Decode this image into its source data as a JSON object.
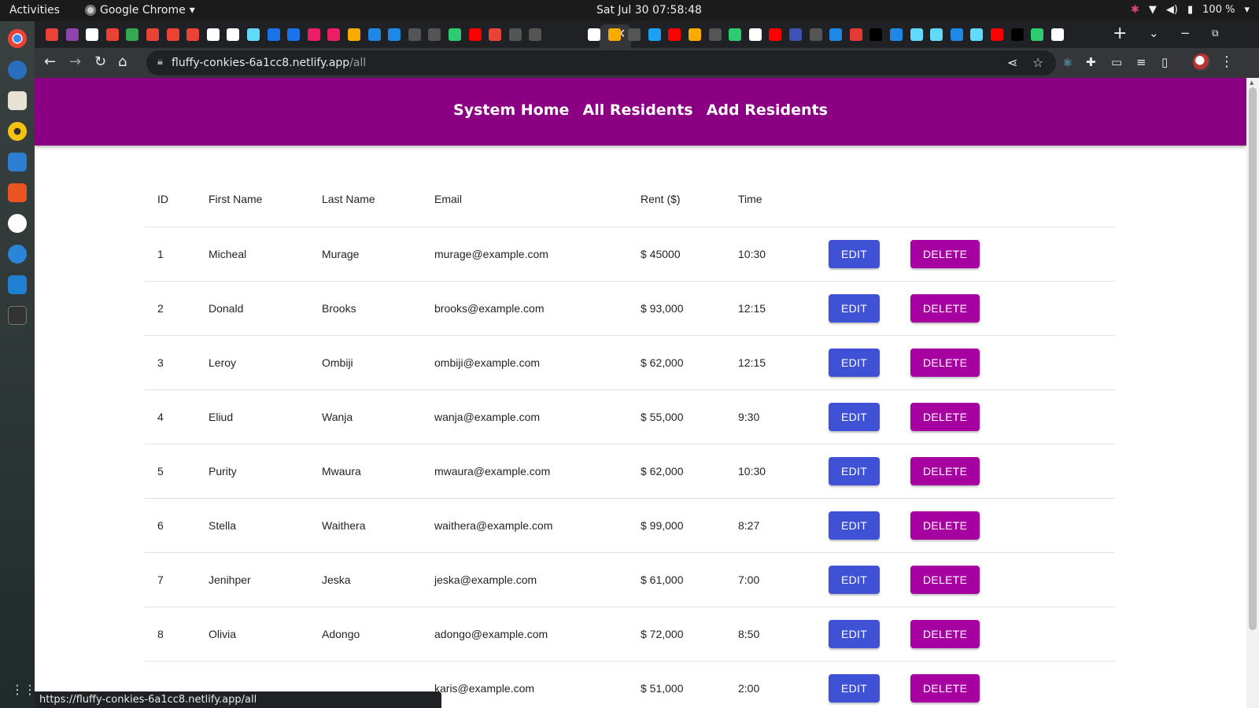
{
  "system": {
    "activities": "Activities",
    "app_name": "Google Chrome",
    "clock": "Sat Jul 30  07:58:48",
    "battery": "100 %"
  },
  "browser": {
    "url_host": "fluffy-conkies-6a1cc8.netlify.app",
    "url_path": "/all",
    "status_url": "https://fluffy-conkies-6a1cc8.netlify.app/all",
    "tab_icon_colors": [
      "#ea4335",
      "#8e44ad",
      "#ffffff",
      "#ea4335",
      "#34a853",
      "#ea4335",
      "#ea4335",
      "#ea4335",
      "#ffffff",
      "#ffffff",
      "#61dafb",
      "#1a73e8",
      "#1a73e8",
      "#e91e63",
      "#e91e63",
      "#f9ab00",
      "#1e88e5",
      "#1e88e5",
      "#555555",
      "#555555",
      "#2ecc71",
      "#ff0000",
      "#ea4335",
      "#555555",
      "#555555"
    ],
    "tab_icon_colors_right": [
      "#ffffff",
      "#f9ab00",
      "#555555",
      "#1da1f2",
      "#ff0000",
      "#f9ab00",
      "#555555",
      "#2ecc71",
      "#ffffff",
      "#ff0000",
      "#3f51b5",
      "#555555",
      "#1e88e5",
      "#e53935",
      "#000000",
      "#1e88e5",
      "#61dafb",
      "#61dafb",
      "#1e88e5",
      "#61dafb",
      "#ff0000",
      "#000000",
      "#2ecc71",
      "#ffffff"
    ]
  },
  "nav": {
    "home": "System Home",
    "all": "All Residents",
    "add": "Add Residents"
  },
  "table": {
    "headers": {
      "id": "ID",
      "first": "First Name",
      "last": "Last Name",
      "email": "Email",
      "rent": "Rent ($)",
      "time": "Time"
    },
    "edit_label": "EDIT",
    "delete_label": "DELETE",
    "rows": [
      {
        "id": "1",
        "first": "Micheal",
        "last": "Murage",
        "email": "murage@example.com",
        "rent": "$ 45000",
        "time": "10:30"
      },
      {
        "id": "2",
        "first": "Donald",
        "last": "Brooks",
        "email": "brooks@example.com",
        "rent": "$ 93,000",
        "time": "12:15"
      },
      {
        "id": "3",
        "first": "Leroy",
        "last": "Ombiji",
        "email": "ombiji@example.com",
        "rent": "$ 62,000",
        "time": "12:15"
      },
      {
        "id": "4",
        "first": "Eliud",
        "last": "Wanja",
        "email": "wanja@example.com",
        "rent": "$ 55,000",
        "time": "9:30"
      },
      {
        "id": "5",
        "first": "Purity",
        "last": "Mwaura",
        "email": "mwaura@example.com",
        "rent": "$ 62,000",
        "time": "10:30"
      },
      {
        "id": "6",
        "first": "Stella",
        "last": "Waithera",
        "email": "waithera@example.com",
        "rent": "$ 99,000",
        "time": "8:27"
      },
      {
        "id": "7",
        "first": "Jenihper",
        "last": "Jeska",
        "email": "jeska@example.com",
        "rent": "$ 61,000",
        "time": "7:00"
      },
      {
        "id": "8",
        "first": "Olivia",
        "last": "Adongo",
        "email": "adongo@example.com",
        "rent": "$ 72,000",
        "time": "8:50"
      },
      {
        "id": "",
        "first": "",
        "last": "",
        "email": "karis@example.com",
        "rent": "$ 51,000",
        "time": "2:00"
      }
    ]
  },
  "colors": {
    "header_bg": "#8b0083",
    "edit_btn": "#3f51d5",
    "delete_btn": "#a700a0"
  }
}
